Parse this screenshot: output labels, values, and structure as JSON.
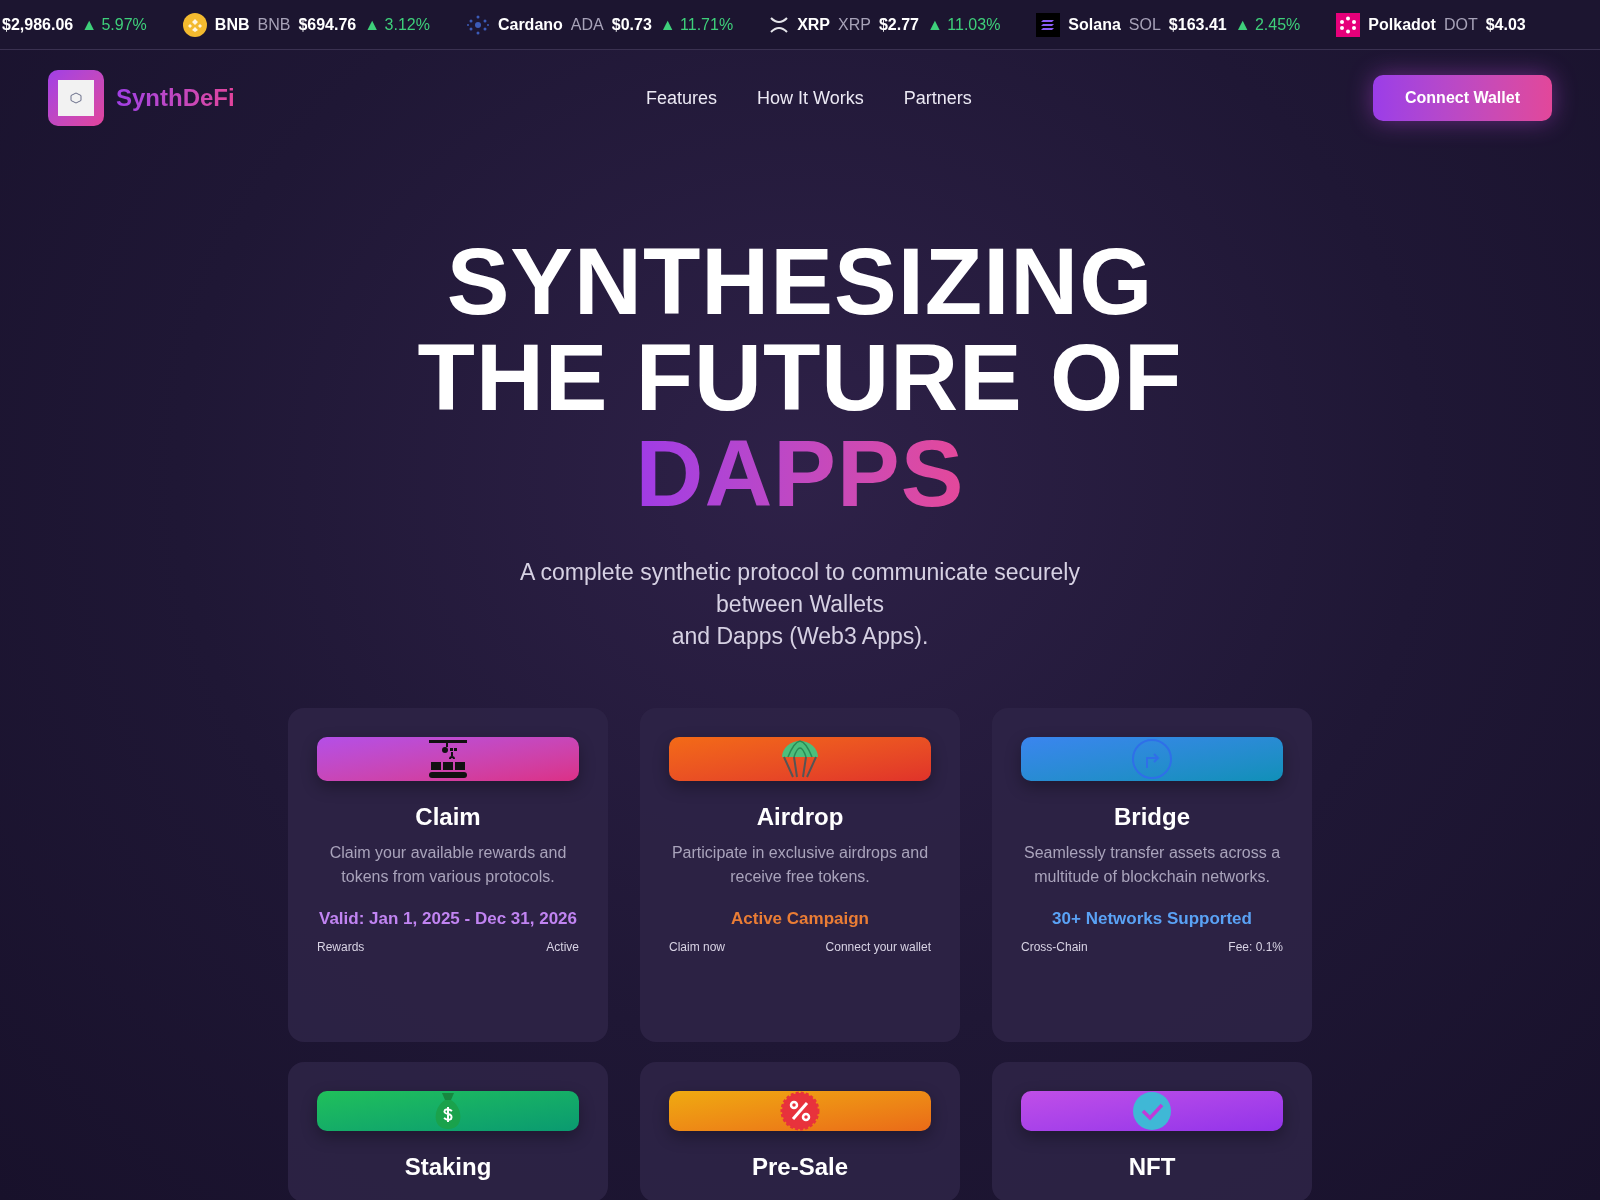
{
  "ticker": [
    {
      "price": "$2,986.06",
      "change": "▲ 5.97%"
    },
    {
      "kind": "bnb",
      "name": "BNB",
      "symbol": "BNB",
      "price": "$694.76",
      "change": "▲ 3.12%"
    },
    {
      "kind": "cardano",
      "name": "Cardano",
      "symbol": "ADA",
      "price": "$0.73",
      "change": "▲ 11.71%"
    },
    {
      "kind": "xrp",
      "name": "XRP",
      "symbol": "XRP",
      "price": "$2.77",
      "change": "▲ 11.03%"
    },
    {
      "kind": "solana",
      "name": "Solana",
      "symbol": "SOL",
      "price": "$163.41",
      "change": "▲ 2.45%"
    },
    {
      "kind": "polkadot",
      "name": "Polkadot",
      "symbol": "DOT",
      "price": "$4.03"
    }
  ],
  "nav": {
    "brand": "SynthDeFi",
    "links": [
      "Features",
      "How It Works",
      "Partners"
    ],
    "button": "Connect Wallet"
  },
  "hero": {
    "title_lines": [
      "SYNTHESIZING",
      "THE FUTURE OF"
    ],
    "highlight": "DAPPS",
    "subtitle_lines": [
      "A complete synthetic protocol to communicate securely",
      "between Wallets",
      "and Dapps (Web3 Apps)."
    ]
  },
  "cards": [
    {
      "kind": "claim",
      "title": "Claim",
      "description": "Claim your available rewards and tokens from various protocols.",
      "highlight": "Valid: Jan 1, 2025 - Dec 31, 2026",
      "footer_left": "Rewards",
      "footer_right": "Active"
    },
    {
      "kind": "airdrop",
      "title": "Airdrop",
      "description": "Participate in exclusive airdrops and receive free tokens.",
      "highlight": "Active Campaign",
      "footer_left": "Claim now",
      "footer_right": "Connect your wallet"
    },
    {
      "kind": "bridge",
      "title": "Bridge",
      "description": "Seamlessly transfer assets across a multitude of blockchain networks.",
      "highlight": "30+ Networks Supported",
      "footer_left": "Cross-Chain",
      "footer_right": "Fee: 0.1%"
    },
    {
      "kind": "staking",
      "title": "Staking"
    },
    {
      "kind": "presale",
      "title": "Pre-Sale"
    },
    {
      "kind": "nft",
      "title": "NFT"
    }
  ]
}
